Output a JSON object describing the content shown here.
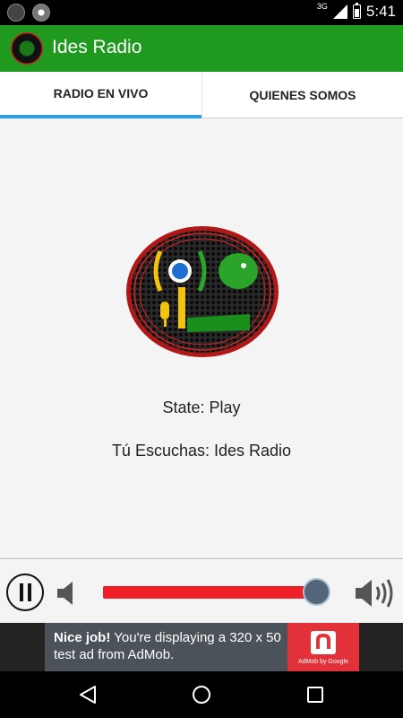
{
  "status_bar": {
    "network": "3G",
    "time": "5:41",
    "icons": [
      "app-notification-icon",
      "disc-icon",
      "signal-icon",
      "battery-icon"
    ]
  },
  "app_bar": {
    "title": "Ides Radio",
    "color": "#1f9a1f"
  },
  "tabs": [
    {
      "label": "RADIO EN VIVO",
      "selected": true
    },
    {
      "label": "QUIENES SOMOS",
      "selected": false
    }
  ],
  "main": {
    "logo_text": "Ides Radio",
    "state_text": "State: Play",
    "listening_text": "Tú Escuchas: Ides Radio"
  },
  "player": {
    "pause_icon": "pause-icon",
    "volume_level": 0.94,
    "volume_color": "#ee1f26"
  },
  "ad": {
    "headline": "Nice job!",
    "body": "You're displaying a 320 x 50 test ad from AdMob.",
    "caption": "AdMob by Google",
    "accent": "#e3313a"
  },
  "nav_bar": {
    "icons": [
      "back-icon",
      "home-icon",
      "recent-apps-icon"
    ]
  }
}
